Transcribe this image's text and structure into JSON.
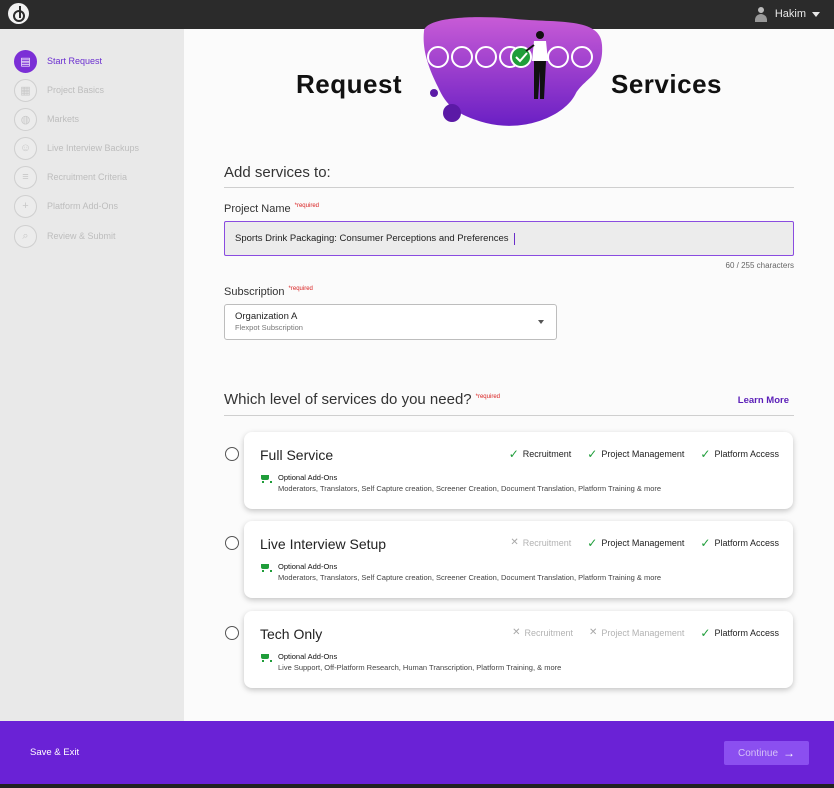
{
  "topbar": {
    "user_name": "Hakim"
  },
  "sidebar": {
    "steps": [
      {
        "label": "Start Request",
        "icon": "clipboard-icon",
        "glyph": "▤"
      },
      {
        "label": "Project Basics",
        "icon": "calendar-icon",
        "glyph": "▦"
      },
      {
        "label": "Markets",
        "icon": "globe-icon",
        "glyph": "◍"
      },
      {
        "label": "Live Interview Backups",
        "icon": "person-icon",
        "glyph": "☺"
      },
      {
        "label": "Recruitment Criteria",
        "icon": "filter-icon",
        "glyph": "≡"
      },
      {
        "label": "Platform Add-Ons",
        "icon": "plus-icon",
        "glyph": "+"
      },
      {
        "label": "Review & Submit",
        "icon": "magnifier-icon",
        "glyph": "⌕"
      }
    ]
  },
  "hero": {
    "title_left": "Request",
    "title_right": "Services"
  },
  "form": {
    "section_title": "Add services to:",
    "project_name_label": "Project Name",
    "required_label": "*required",
    "project_name_value": "Sports Drink Packaging: Consumer Perceptions and Preferences",
    "char_count": "60 / 255 characters",
    "subscription_label": "Subscription",
    "subscription_value": "Organization A",
    "subscription_sub": "Flexpot Subscription"
  },
  "services": {
    "title": "Which level of services do you need?",
    "learn_more": "Learn More",
    "addon_title": "Optional Add-Ons",
    "options": [
      {
        "name": "Full Service",
        "features": [
          {
            "label": "Recruitment",
            "included": true
          },
          {
            "label": "Project Management",
            "included": true
          },
          {
            "label": "Platform Access",
            "included": true
          }
        ],
        "addons": "Moderators, Translators, Self Capture creation, Screener Creation, Document Translation, Platform Training & more"
      },
      {
        "name": "Live Interview Setup",
        "features": [
          {
            "label": "Recruitment",
            "included": false
          },
          {
            "label": "Project Management",
            "included": true
          },
          {
            "label": "Platform Access",
            "included": true
          }
        ],
        "addons": "Moderators, Translators, Self Capture creation, Screener Creation, Document Translation, Platform Training & more"
      },
      {
        "name": "Tech Only",
        "features": [
          {
            "label": "Recruitment",
            "included": false
          },
          {
            "label": "Project Management",
            "included": false
          },
          {
            "label": "Platform Access",
            "included": true
          }
        ],
        "addons": "Live Support, Off-Platform Research, Human Transcription, Platform Training, & more"
      }
    ]
  },
  "footer": {
    "save_exit": "Save & Exit",
    "continue": "Continue"
  },
  "colors": {
    "accent": "#6a22d6",
    "check": "#1f9d3a",
    "required": "#d81e1e"
  }
}
